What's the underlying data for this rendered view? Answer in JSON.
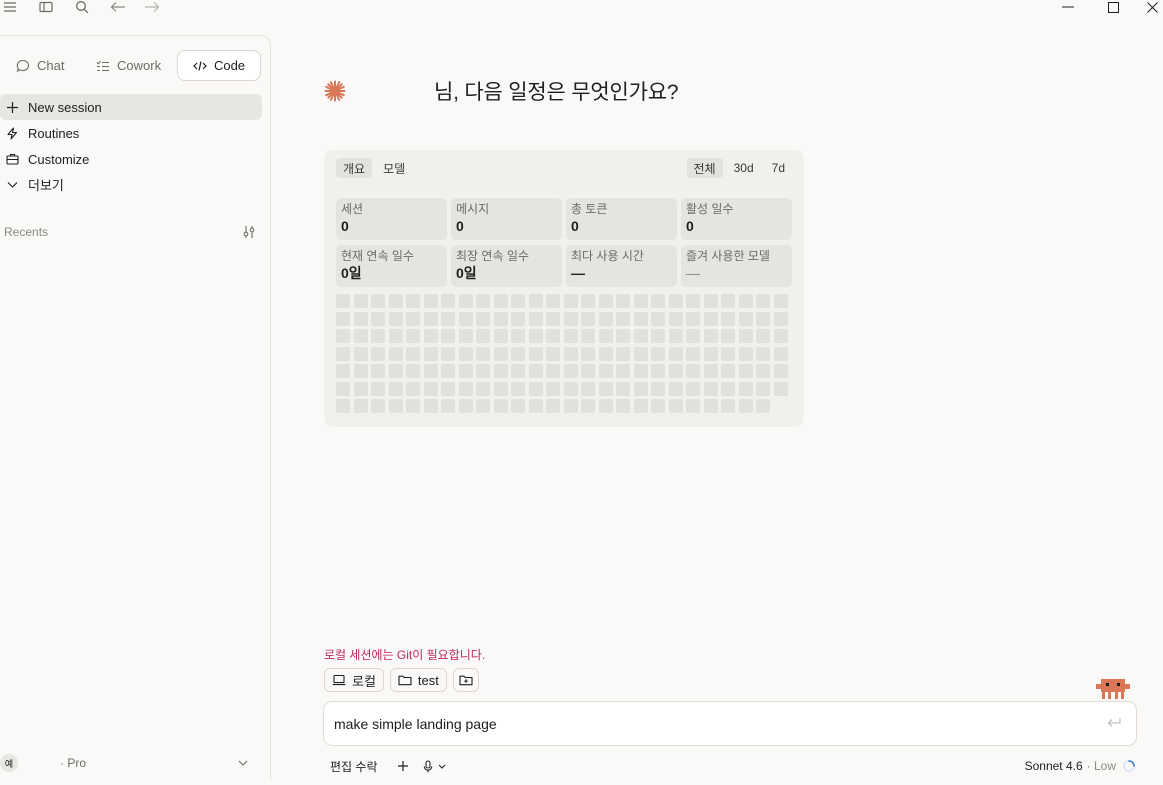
{
  "titlebar": {
    "menu_icon": "hamburger-icon",
    "sidebar_icon": "sidebar-toggle-icon",
    "search_icon": "search-icon",
    "back_icon": "arrow-left-icon",
    "forward_icon": "arrow-right-icon"
  },
  "modes": [
    {
      "label": "Chat",
      "icon": "chat-bubble-icon"
    },
    {
      "label": "Cowork",
      "icon": "checklist-icon"
    },
    {
      "label": "Code",
      "icon": "code-icon",
      "active": true
    }
  ],
  "nav": [
    {
      "label": "New session",
      "icon": "plus-icon",
      "active": true
    },
    {
      "label": "Routines",
      "icon": "bolt-icon"
    },
    {
      "label": "Customize",
      "icon": "briefcase-icon"
    },
    {
      "label": "더보기",
      "icon": "chevron-down-icon"
    }
  ],
  "recents": {
    "label": "Recents",
    "icon": "filter-sliders-icon"
  },
  "user": {
    "avatar_initial": "예",
    "plan": "· Pro"
  },
  "greeting": {
    "suffix": "님, 다음 일정은 무엇인가요?",
    "logo": "sparkle-logo",
    "accent": "#d97757"
  },
  "stats": {
    "left_tabs": [
      "개요",
      "모델"
    ],
    "right_tabs": [
      "전체",
      "30d",
      "7d"
    ],
    "cards": [
      {
        "label": "세션",
        "value": "0"
      },
      {
        "label": "메시지",
        "value": "0"
      },
      {
        "label": "총 토큰",
        "value": "0"
      },
      {
        "label": "활성 일수",
        "value": "0"
      },
      {
        "label": "현재 연속 일수",
        "value": "0일"
      },
      {
        "label": "최장 연속 일수",
        "value": "0일"
      },
      {
        "label": "최다 사용 시간",
        "value": "—"
      },
      {
        "label": "즐겨 사용한 모델",
        "value": "—"
      }
    ]
  },
  "composer": {
    "git_warning": "로컬 세션에는 Git이 필요합니다.",
    "warning_color": "#c0275b",
    "chips": [
      {
        "label": "로컬",
        "icon": "laptop-icon"
      },
      {
        "label": "test",
        "icon": "folder-icon"
      },
      {
        "label": "",
        "icon": "folder-plus-icon"
      }
    ],
    "input_value": "make simple landing page",
    "send_icon": "enter-icon"
  },
  "bottom": {
    "permission_label": "편집 수락",
    "add_icon": "plus-icon",
    "mic_icon": "microphone-icon",
    "model": "Sonnet 4.6",
    "effort": "· Low"
  }
}
